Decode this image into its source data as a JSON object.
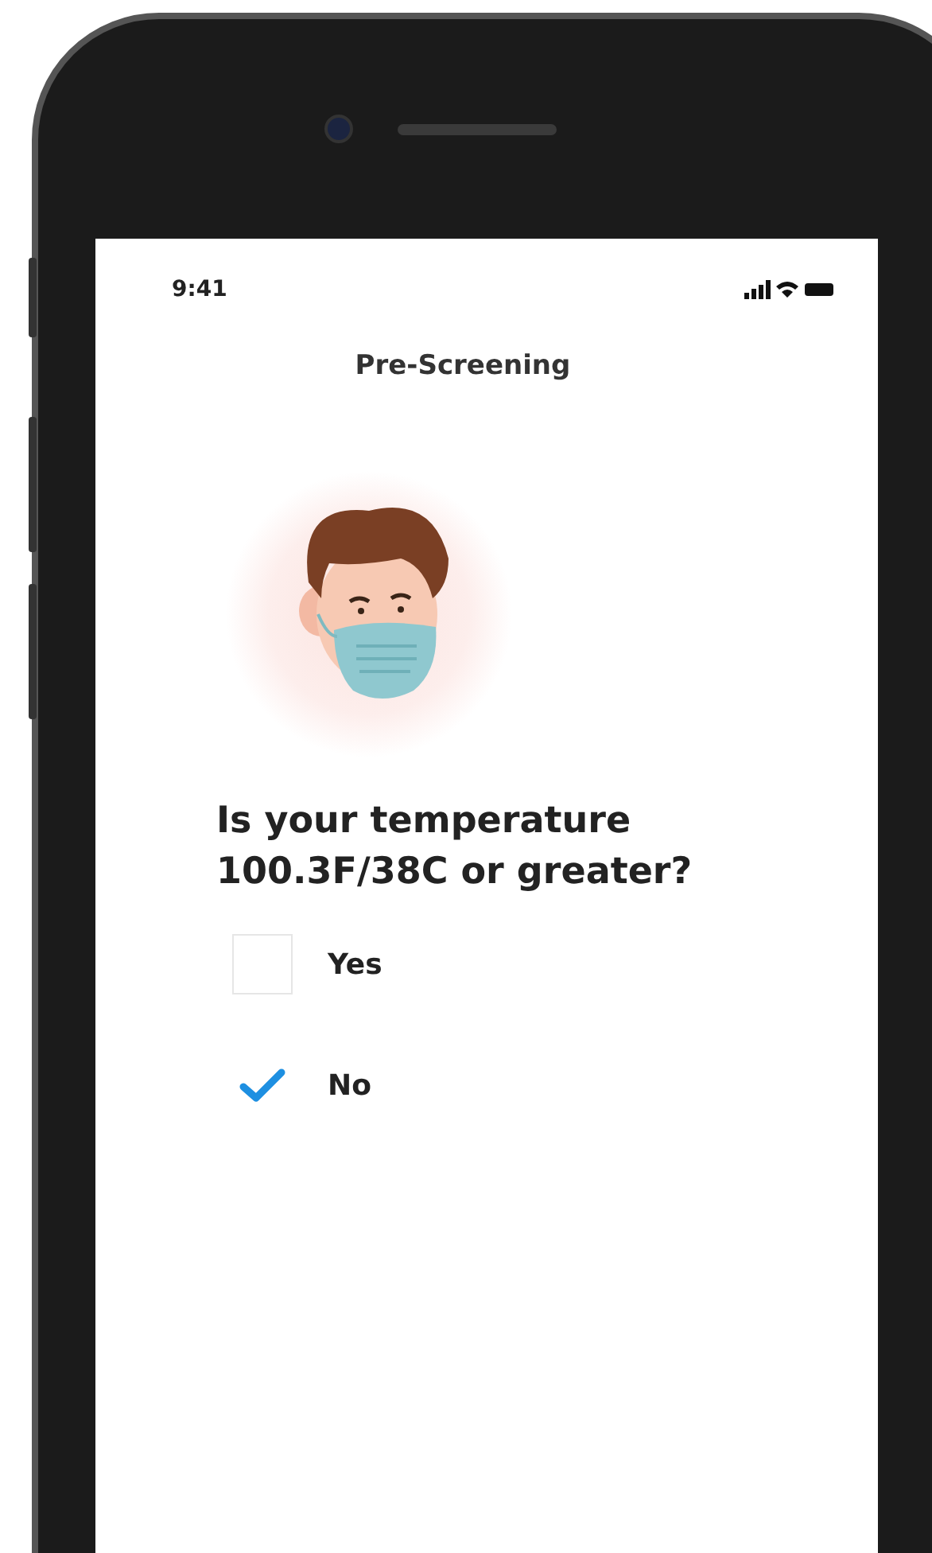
{
  "status_bar": {
    "time": "9:41"
  },
  "header": {
    "title": "Pre-Screening"
  },
  "question": "Is your temperature 100.3F/38C or greater?",
  "options": [
    {
      "label": "Yes",
      "checked": false
    },
    {
      "label": "No",
      "checked": true
    }
  ]
}
